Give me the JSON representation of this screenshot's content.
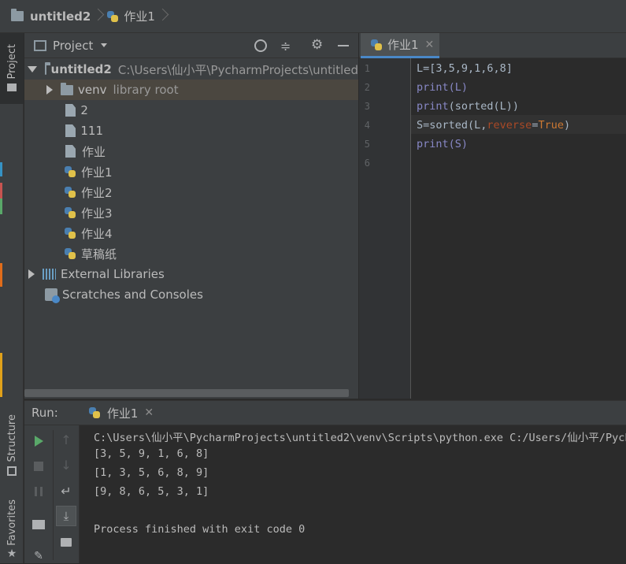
{
  "navbar": {
    "project": "untitled2",
    "file": "作业1"
  },
  "sidebar": {
    "project_tab": "Project",
    "structure_tab": "Structure",
    "favorites_tab": "Favorites"
  },
  "project_panel": {
    "title": "Project",
    "root_name": "untitled2",
    "root_path": "C:\\Users\\仙小平\\PycharmProjects\\untitled",
    "items": [
      {
        "label": "venv",
        "note": "library root"
      },
      {
        "label": "2"
      },
      {
        "label": "111"
      },
      {
        "label": "作业"
      },
      {
        "label": "作业1"
      },
      {
        "label": "作业2"
      },
      {
        "label": "作业3"
      },
      {
        "label": "作业4"
      },
      {
        "label": "草稿纸"
      },
      {
        "label": "External Libraries"
      },
      {
        "label": "Scratches and Consoles"
      }
    ]
  },
  "editor": {
    "tab_label": "作业1",
    "line_numbers": [
      "1",
      "2",
      "3",
      "4",
      "5",
      "6"
    ],
    "code": {
      "l1": "L=[3,5,9,1,6,8]",
      "l2": "print(L)",
      "l3_fn": "print",
      "l3_inner": "(sorted(L))",
      "l4_a": "S=sorted(L,",
      "l4_kw": "reverse",
      "l4_eq": "=",
      "l4_val": "True",
      "l4_end": ")",
      "l5": "print(S)"
    }
  },
  "run": {
    "label": "Run:",
    "tab_label": "作业1",
    "output": [
      "C:\\Users\\仙小平\\PycharmProjects\\untitled2\\venv\\Scripts\\python.exe C:/Users/仙小平/Pych",
      "[3, 5, 9, 1, 6, 8]",
      "[1, 3, 5, 6, 8, 9]",
      "[9, 8, 6, 5, 3, 1]",
      "",
      "Process finished with exit code 0"
    ]
  },
  "colors": {
    "keyword": "#cc7832",
    "builtin": "#8888c6",
    "number": "#6897bb",
    "kwarg": "#aa4926",
    "accent": "#4a88c7"
  }
}
